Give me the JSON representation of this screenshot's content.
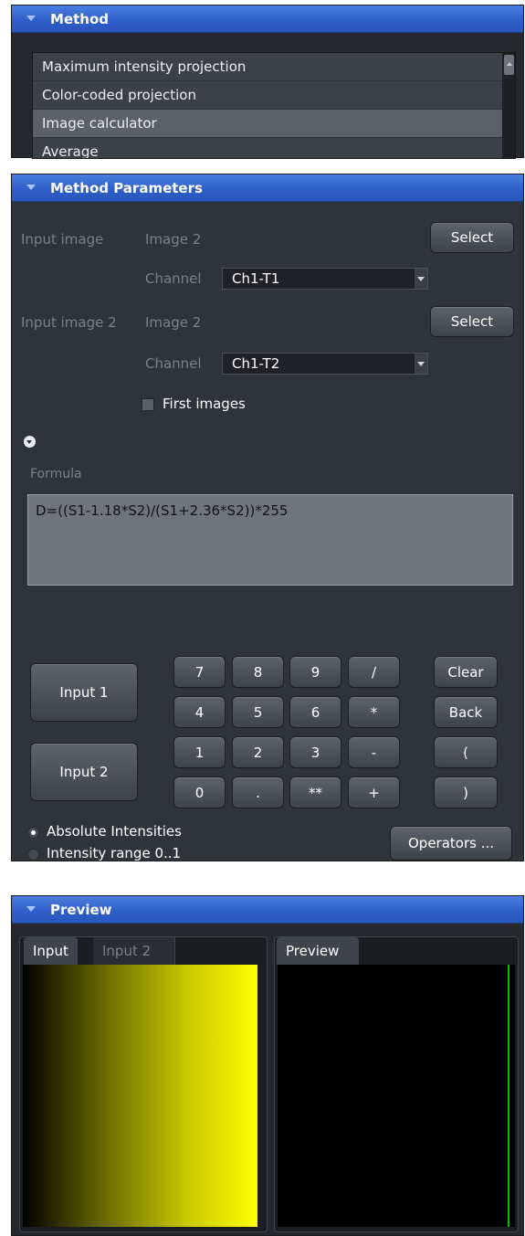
{
  "method": {
    "header": "Method",
    "items": [
      {
        "label": "Maximum intensity projection"
      },
      {
        "label": "Color-coded projection"
      },
      {
        "label": "Image calculator"
      },
      {
        "label": "Average"
      }
    ],
    "selected": "Image calculator"
  },
  "params": {
    "header": "Method Parameters",
    "input1": {
      "label": "Input image",
      "value": "Image 2",
      "select_label": "Select",
      "channel_label": "Channel",
      "channel_value": "Ch1-T1"
    },
    "input2": {
      "label": "Input image 2",
      "value": "Image 2",
      "select_label": "Select",
      "channel_label": "Channel",
      "channel_value": "Ch1-T2"
    },
    "first_images_label": "First images",
    "first_images_checked": false,
    "formula_label": "Formula",
    "formula_value": "D=((S1-1.18*S2)/(S1+2.36*S2))*255",
    "keypad": {
      "input1": "Input 1",
      "input2": "Input 2",
      "keys": [
        "7",
        "8",
        "9",
        "/",
        "4",
        "5",
        "6",
        "*",
        "1",
        "2",
        "3",
        "-",
        "0",
        ".",
        "**",
        "+"
      ],
      "clear": "Clear",
      "back": "Back",
      "open_paren": "(",
      "close_paren": ")"
    },
    "radio": {
      "absolute": "Absolute Intensities",
      "range": "Intensity range 0..1",
      "selected": "absolute"
    },
    "operators_label": "Operators ..."
  },
  "preview": {
    "header": "Preview",
    "left_tabs": [
      "Input",
      "Input 2"
    ],
    "right_tabs": [
      "Preview"
    ],
    "colors": {
      "yellow": "#ffff00",
      "green_line": "#00c000",
      "black": "#000000"
    }
  }
}
